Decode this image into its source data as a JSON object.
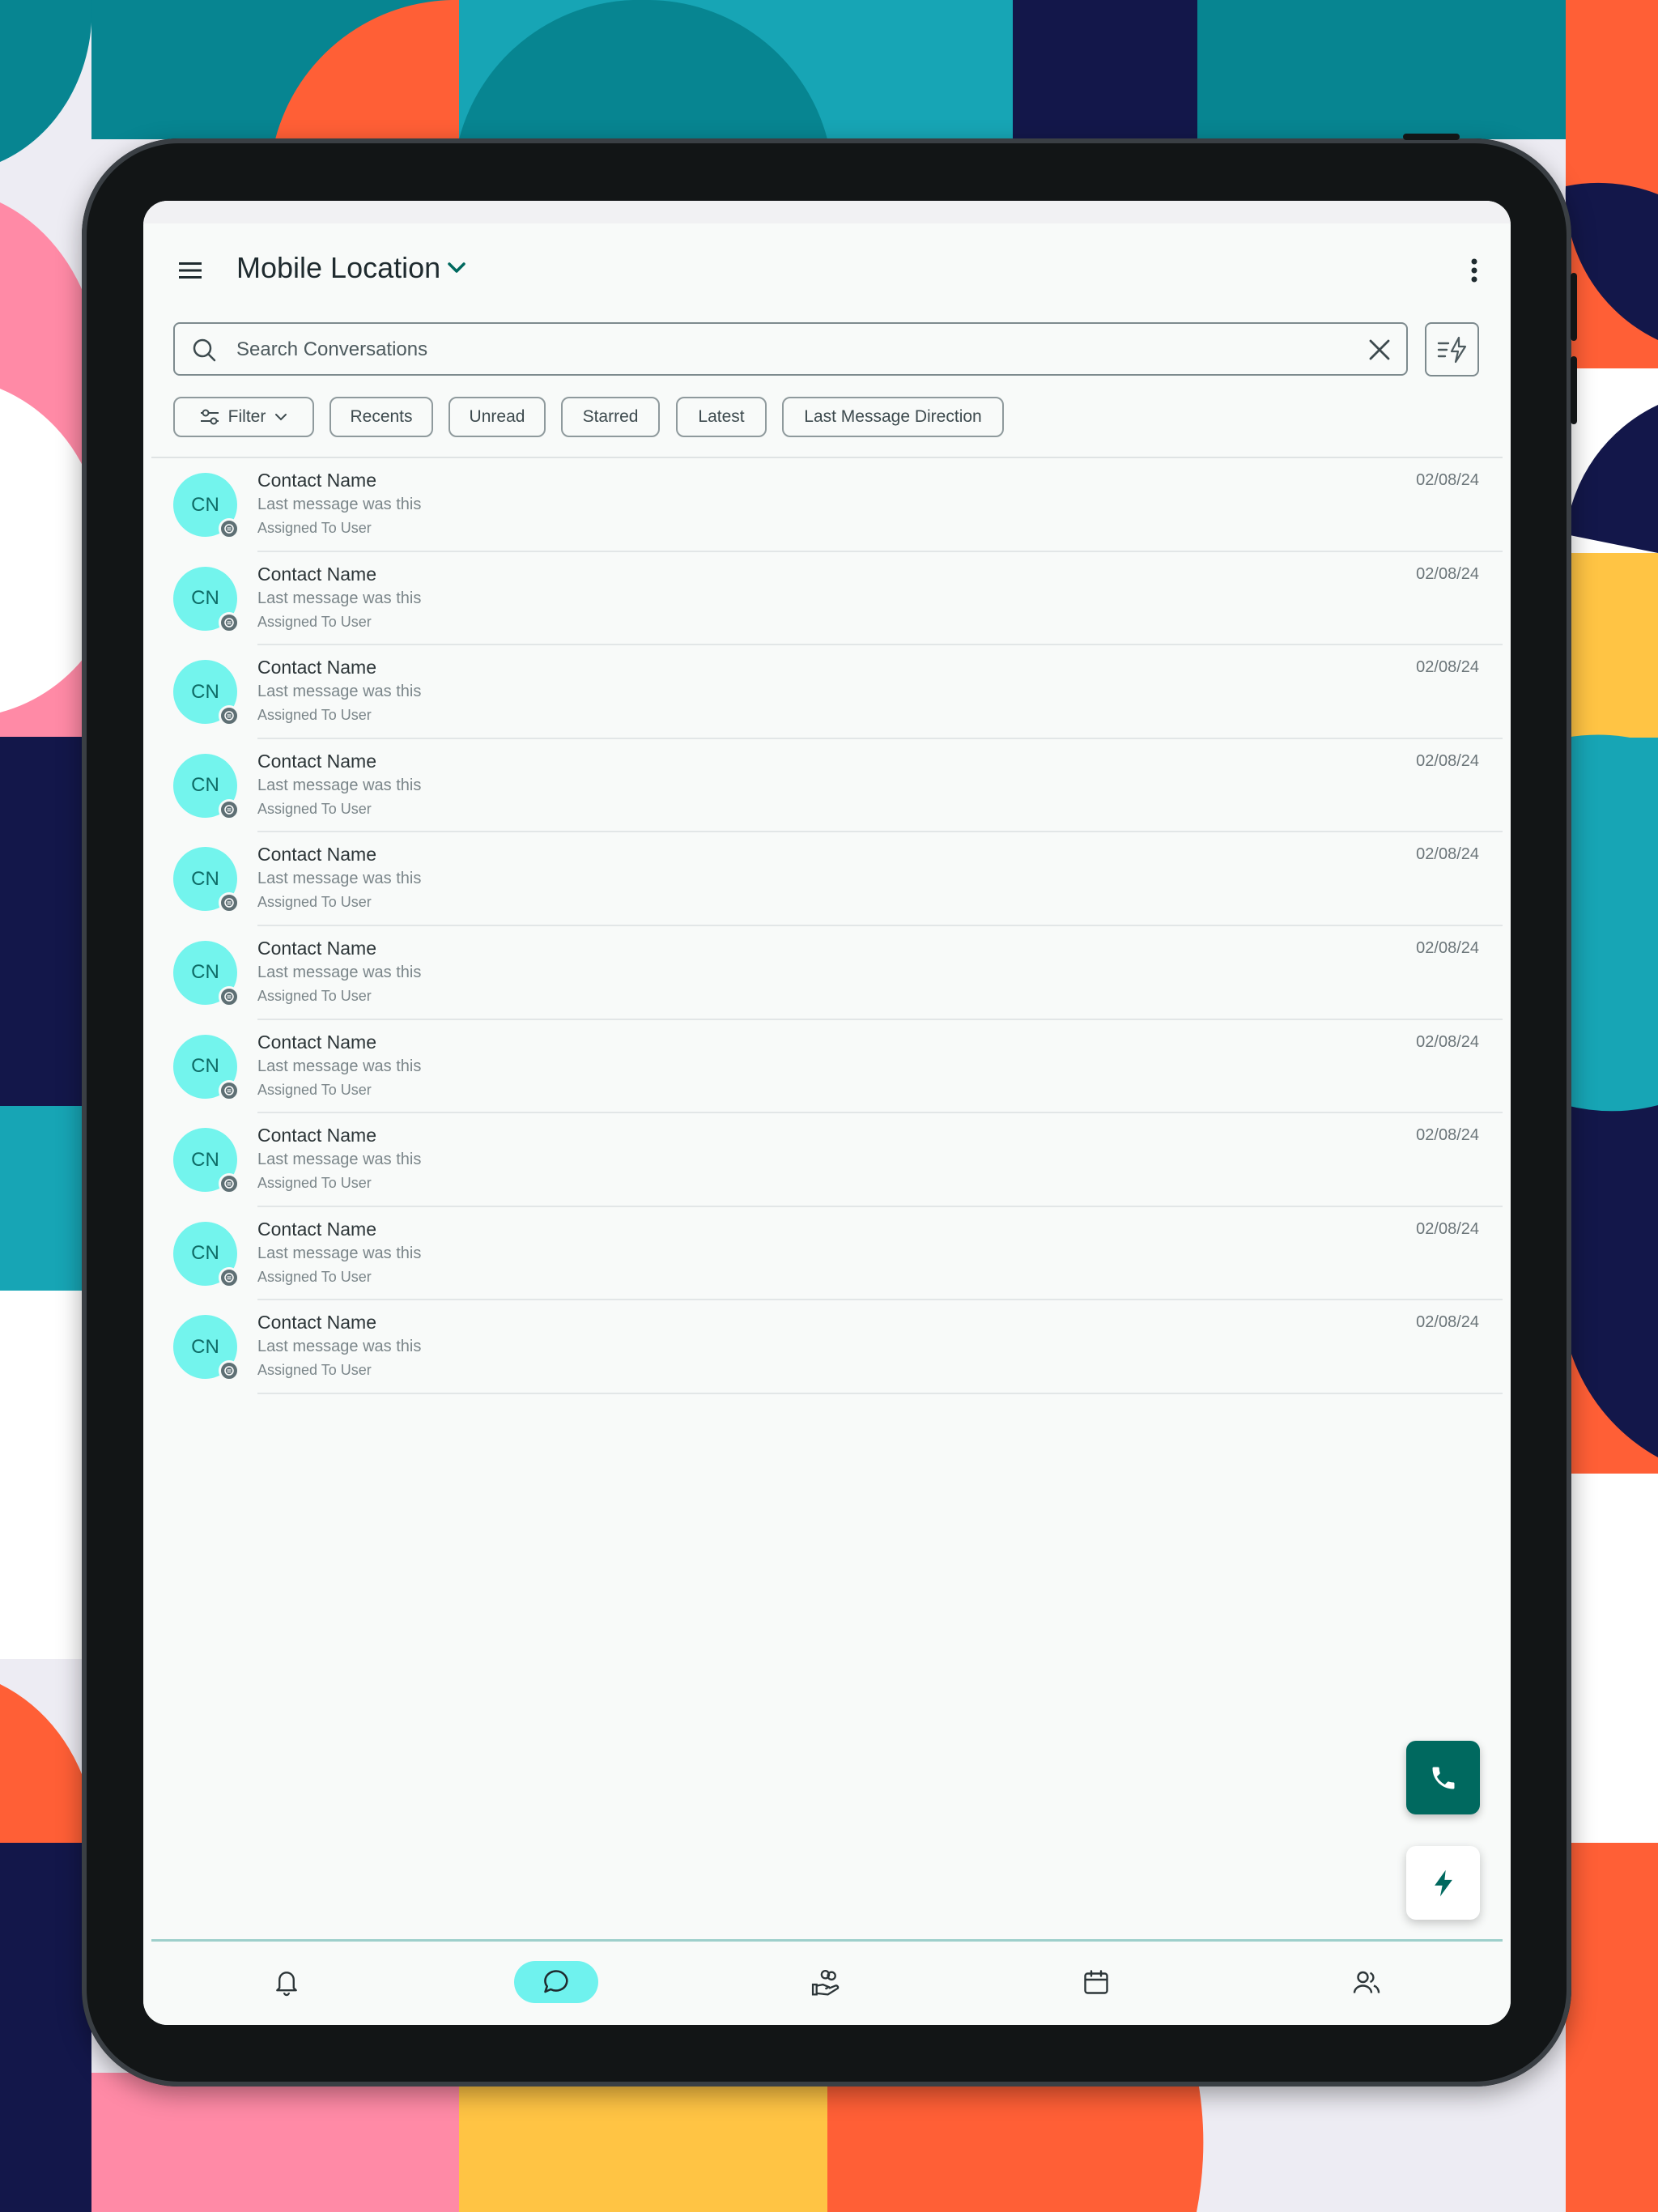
{
  "header": {
    "menu_icon": "hamburger-menu-icon",
    "title": "Mobile Location",
    "title_dropdown_icon": "chevron-down-icon",
    "more_icon": "more-vertical-icon"
  },
  "search": {
    "placeholder": "Search Conversations",
    "value": "",
    "search_icon": "search-icon",
    "clear_icon": "close-icon",
    "quick_action_icon": "filter-bolt-icon"
  },
  "chips": [
    {
      "label": "Filter",
      "icon": "sliders-icon",
      "trailing_icon": "chevron-down-icon"
    },
    {
      "label": "Recents"
    },
    {
      "label": "Unread"
    },
    {
      "label": "Starred"
    },
    {
      "label": "Latest"
    },
    {
      "label": "Last Message Direction"
    }
  ],
  "conversations": [
    {
      "initials": "CN",
      "name": "Contact Name",
      "message": "Last message was this",
      "assigned": "Assigned To User",
      "date": "02/08/24",
      "channel_icon": "chat-bubble-icon"
    },
    {
      "initials": "CN",
      "name": "Contact Name",
      "message": "Last message was this",
      "assigned": "Assigned To User",
      "date": "02/08/24",
      "channel_icon": "chat-bubble-icon"
    },
    {
      "initials": "CN",
      "name": "Contact Name",
      "message": "Last message was this",
      "assigned": "Assigned To User",
      "date": "02/08/24",
      "channel_icon": "chat-bubble-icon"
    },
    {
      "initials": "CN",
      "name": "Contact Name",
      "message": "Last message was this",
      "assigned": "Assigned To User",
      "date": "02/08/24",
      "channel_icon": "chat-bubble-icon"
    },
    {
      "initials": "CN",
      "name": "Contact Name",
      "message": "Last message was this",
      "assigned": "Assigned To User",
      "date": "02/08/24",
      "channel_icon": "chat-bubble-icon"
    },
    {
      "initials": "CN",
      "name": "Contact Name",
      "message": "Last message was this",
      "assigned": "Assigned To User",
      "date": "02/08/24",
      "channel_icon": "chat-bubble-icon"
    },
    {
      "initials": "CN",
      "name": "Contact Name",
      "message": "Last message was this",
      "assigned": "Assigned To User",
      "date": "02/08/24",
      "channel_icon": "chat-bubble-icon"
    },
    {
      "initials": "CN",
      "name": "Contact Name",
      "message": "Last message was this",
      "assigned": "Assigned To User",
      "date": "02/08/24",
      "channel_icon": "chat-bubble-icon"
    },
    {
      "initials": "CN",
      "name": "Contact Name",
      "message": "Last message was this",
      "assigned": "Assigned To User",
      "date": "02/08/24",
      "channel_icon": "chat-bubble-icon"
    },
    {
      "initials": "CN",
      "name": "Contact Name",
      "message": "Last message was this",
      "assigned": "Assigned To User",
      "date": "02/08/24",
      "channel_icon": "chat-bubble-icon"
    }
  ],
  "fabs": {
    "call_icon": "phone-icon",
    "quick_icon": "bolt-icon"
  },
  "bottom_nav": [
    {
      "icon": "bell-icon",
      "active": false
    },
    {
      "icon": "chat-bubble-icon",
      "active": true
    },
    {
      "icon": "hand-heart-icon",
      "active": false
    },
    {
      "icon": "calendar-icon",
      "active": false
    },
    {
      "icon": "users-icon",
      "active": false
    }
  ],
  "colors": {
    "accent": "#00695f",
    "avatar_bg": "#73f4ed",
    "nav_active_bg": "#6ff2ee",
    "screen_bg": "#f8faf9",
    "device_frame": "#121516"
  }
}
